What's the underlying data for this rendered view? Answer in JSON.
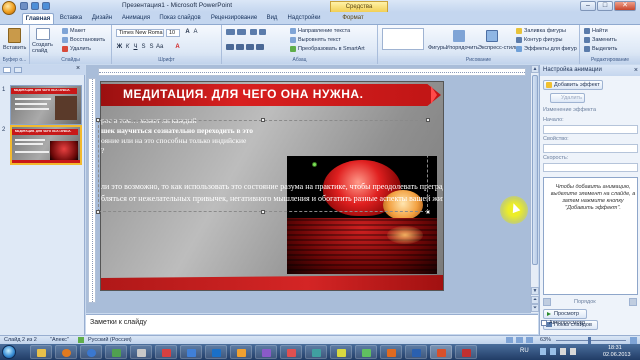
{
  "window": {
    "title": "Презентация1 - Microsoft PowerPoint",
    "contextual_tab": "Средства рисования",
    "controls": {
      "minimize": "–",
      "maximize": "□",
      "close": "✕"
    }
  },
  "ribbon": {
    "tabs": [
      "Главная",
      "Вставка",
      "Дизайн",
      "Анимация",
      "Показ слайдов",
      "Рецензирование",
      "Вид",
      "Надстройки",
      "Формат"
    ],
    "active_tab": "Главная",
    "clipboard": {
      "paste": "Вставить",
      "label": "Буфер о..."
    },
    "slides": {
      "create": "Создать слайд",
      "layout": "Макет",
      "reset": "Восстановить",
      "delete": "Удалить",
      "label": "Слайды"
    },
    "font": {
      "name": "Times New Roma",
      "size": "10",
      "label": "Шрифт"
    },
    "paragraph": {
      "direction": "Направление текста",
      "align": "Выровнять текст",
      "smartart": "Преобразовать в SmartArt",
      "label": "Абзац"
    },
    "drawing": {
      "shapes": "Фигуры",
      "arrange": "Упорядочить",
      "styles": "Экспресс-стили",
      "fill": "Заливка фигуры",
      "outline": "Контур фигуры",
      "effects": "Эффекты для фигур",
      "label": "Рисование"
    },
    "editing": {
      "find": "Найти",
      "replace": "Заменить",
      "select": "Выделить",
      "label": "Редактирование"
    }
  },
  "thumbnails": {
    "tabs": [
      "",
      ""
    ],
    "slides": [
      {
        "num": "1",
        "title": "МЕДИТАЦИЯ. ДЛЯ ЧЕГО ОНА НУЖНА."
      },
      {
        "num": "2",
        "title": "МЕДИТАЦИЯ. ДЛЯ ЧЕГО ОНА НУЖНА."
      }
    ]
  },
  "slide": {
    "title": "МЕДИТАЦИЯ. ДЛЯ ЧЕГО ОНА НУЖНА.",
    "text_top": [
      "рос в том… может ли каждый",
      "шек научиться сознательно переходить в это",
      "ояние или на это способны только индийские",
      "?"
    ],
    "text_mid": [
      "ли это возможно, то как использовать это состояние разума на практике, чтобы преодолевать преграды,",
      "бляться от нежелательных привычек, негативного мышления и обогатить разные аспекты вашей жизни?"
    ],
    "photo_alt": "rose-reflection-photo"
  },
  "notes": {
    "placeholder": "Заметки к слайду"
  },
  "task_pane": {
    "title": "Настройка анимации",
    "add_effect": "Добавить эффект",
    "remove": "Удалить",
    "change_label": "Изменение эффекта",
    "start_label": "Начало:",
    "property_label": "Свойство:",
    "speed_label": "Скорость:",
    "hint": "Чтобы добавить анимацию, выделите элемент на слайде, а затем нажмите кнопку \"Добавить эффект\".",
    "order_label": "Порядок",
    "play": "Просмотр",
    "slideshow": "Показ слайдов",
    "autopreview": "Автопросмотр"
  },
  "status": {
    "slide": "Слайд 2 из 2",
    "theme": "\"Апекс\"",
    "language": "Русский (Россия)",
    "zoom": "63%"
  },
  "taskbar": {
    "lang": "RU",
    "time": "18:31",
    "date": "02.06.2013"
  },
  "colors": {
    "title_red": "#d82020",
    "ribbon_blue": "#c4d6ef",
    "highlight_yellow": "#f0f030"
  }
}
